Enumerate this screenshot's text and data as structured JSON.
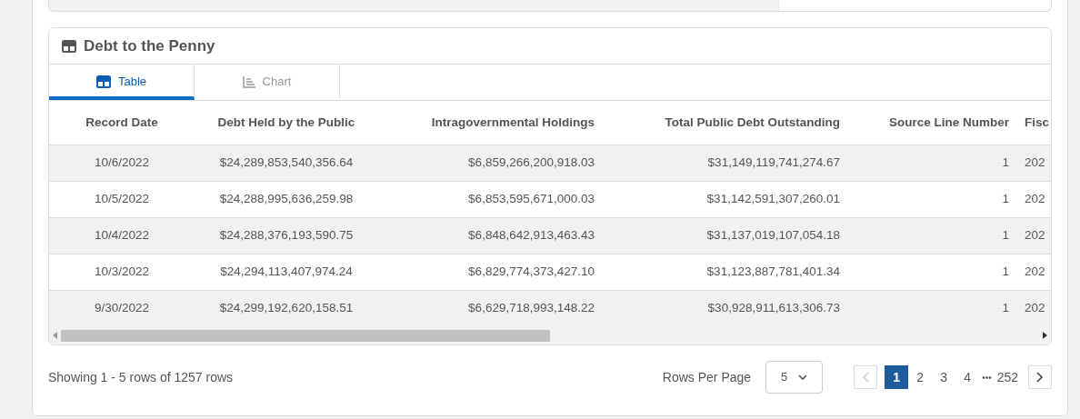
{
  "card": {
    "title": "Debt to the Penny",
    "tabs": [
      {
        "label": "Table",
        "kind": "table",
        "selected": true
      },
      {
        "label": "Chart",
        "kind": "chart",
        "selected": false
      }
    ],
    "table": {
      "columns": [
        "Record Date",
        "Debt Held by the Public",
        "Intragovernmental Holdings",
        "Total Public Debt Outstanding",
        "Source Line Number",
        "Fisc"
      ],
      "rows": [
        [
          "10/6/2022",
          "$24,289,853,540,356.64",
          "$6,859,266,200,918.03",
          "$31,149,119,741,274.67",
          "1",
          "202"
        ],
        [
          "10/5/2022",
          "$24,288,995,636,259.98",
          "$6,853,595,671,000.03",
          "$31,142,591,307,260.01",
          "1",
          "202"
        ],
        [
          "10/4/2022",
          "$24,288,376,193,590.75",
          "$6,848,642,913,463.43",
          "$31,137,019,107,054.18",
          "1",
          "202"
        ],
        [
          "10/3/2022",
          "$24,294,113,407,974.24",
          "$6,829,774,373,427.10",
          "$31,123,887,781,401.34",
          "1",
          "202"
        ],
        [
          "9/30/2022",
          "$24,299,192,620,158.51",
          "$6,629,718,993,148.22",
          "$30,928,911,613,306.73",
          "1",
          "202"
        ]
      ]
    },
    "footer": {
      "summary": "Showing 1 - 5 rows of 1257 rows",
      "rows_per_page_label": "Rows Per Page",
      "rows_per_page": "5",
      "prev": {
        "disabled": true
      },
      "next": {
        "disabled": false
      },
      "pages": [
        {
          "label": "1",
          "kind": "page",
          "selected": true
        },
        {
          "label": "2",
          "kind": "page",
          "selected": false
        },
        {
          "label": "3",
          "kind": "page",
          "selected": false
        },
        {
          "label": "4",
          "kind": "page",
          "selected": false
        },
        {
          "label": "•••",
          "kind": "ellipsis"
        },
        {
          "label": "252",
          "kind": "page",
          "selected": false
        }
      ]
    }
  }
}
